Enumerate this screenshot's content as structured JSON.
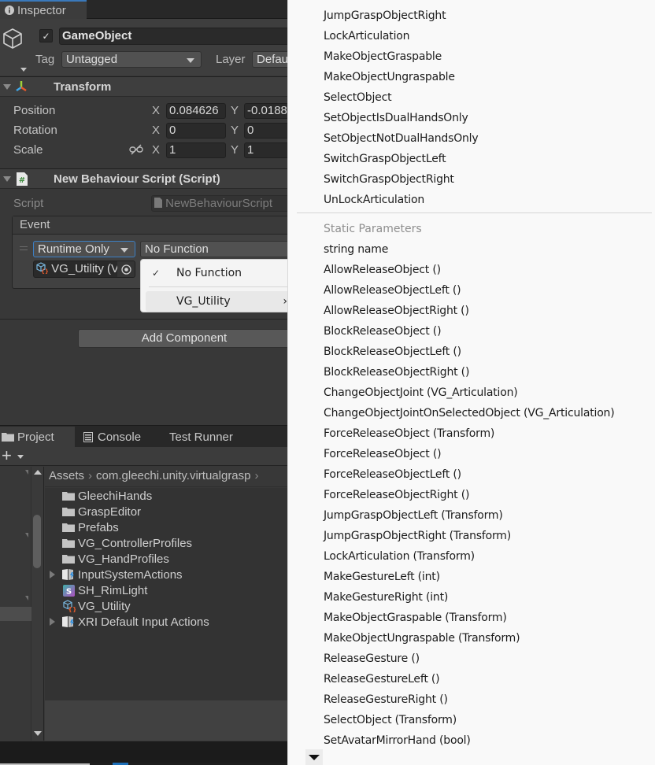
{
  "inspector": {
    "tab_label": "Inspector",
    "gameobject": {
      "active": true,
      "name": "GameObject",
      "tag_label": "Tag",
      "tag_value": "Untagged",
      "layer_label": "Layer",
      "layer_value": "Default"
    },
    "transform": {
      "title": "Transform",
      "rows": [
        {
          "label": "Position",
          "x": "0.084626",
          "y": "-0.0188"
        },
        {
          "label": "Rotation",
          "x": "0",
          "y": "0"
        },
        {
          "label": "Scale",
          "x": "1",
          "y": "1"
        }
      ],
      "axis_x": "X",
      "axis_y": "Y"
    },
    "script_component": {
      "title": "New Behaviour Script (Script)",
      "script_label": "Script",
      "script_value": "NewBehaviourScript",
      "event_title": "Event",
      "call_state": "Runtime Only",
      "function": "No Function",
      "target_object": "VG_Utility (V"
    },
    "function_menu": {
      "items": [
        {
          "label": "No Function",
          "checked": true
        },
        {
          "label": "VG_Utility",
          "submenu": true
        }
      ]
    },
    "add_component_label": "Add Component"
  },
  "project": {
    "tabs": [
      {
        "label": "Project",
        "active": true,
        "icon": "folder-icon"
      },
      {
        "label": "Console",
        "active": false,
        "icon": "console-icon"
      },
      {
        "label": "Test Runner",
        "active": false
      }
    ],
    "breadcrumb": [
      "Assets",
      "com.gleechi.unity.virtualgrasp"
    ],
    "files": [
      {
        "name": "GleechiHands",
        "icon": "folder-icon",
        "expandable": false
      },
      {
        "name": "GraspEditor",
        "icon": "folder-icon",
        "expandable": false
      },
      {
        "name": "Prefabs",
        "icon": "folder-icon",
        "expandable": false
      },
      {
        "name": "VG_ControllerProfiles",
        "icon": "folder-icon",
        "expandable": false
      },
      {
        "name": "VG_HandProfiles",
        "icon": "folder-icon",
        "expandable": false
      },
      {
        "name": "InputSystemActions",
        "icon": "input-actions-icon",
        "expandable": true
      },
      {
        "name": "SH_RimLight",
        "icon": "shader-icon",
        "expandable": false
      },
      {
        "name": "VG_Utility",
        "icon": "script-prefab-icon",
        "expandable": false
      },
      {
        "name": "XRI Default Input Actions",
        "icon": "input-actions-icon",
        "expandable": true
      }
    ]
  },
  "method_popup": {
    "dynamic_items": [
      "JumpGraspObjectRight",
      "LockArticulation",
      "MakeObjectGraspable",
      "MakeObjectUngraspable",
      "SelectObject",
      "SetObjectIsDualHandsOnly",
      "SetObjectNotDualHandsOnly",
      "SwitchGraspObjectLeft",
      "SwitchGraspObjectRight",
      "UnLockArticulation"
    ],
    "static_header": "Static Parameters",
    "static_items": [
      "string name",
      "AllowReleaseObject ()",
      "AllowReleaseObjectLeft ()",
      "AllowReleaseObjectRight ()",
      "BlockReleaseObject ()",
      "BlockReleaseObjectLeft ()",
      "BlockReleaseObjectRight ()",
      "ChangeObjectJoint (VG_Articulation)",
      "ChangeObjectJointOnSelectedObject (VG_Articulation)",
      "ForceReleaseObject (Transform)",
      "ForceReleaseObject ()",
      "ForceReleaseObjectLeft ()",
      "ForceReleaseObjectRight ()",
      "JumpGraspObjectLeft (Transform)",
      "JumpGraspObjectRight (Transform)",
      "LockArticulation (Transform)",
      "MakeGestureLeft (int)",
      "MakeGestureRight (int)",
      "MakeObjectGraspable (Transform)",
      "MakeObjectUngraspable (Transform)",
      "ReleaseGesture ()",
      "ReleaseGestureLeft ()",
      "ReleaseGestureRight ()",
      "SelectObject (Transform)",
      "SetAvatarMirrorHand (bool)"
    ]
  }
}
